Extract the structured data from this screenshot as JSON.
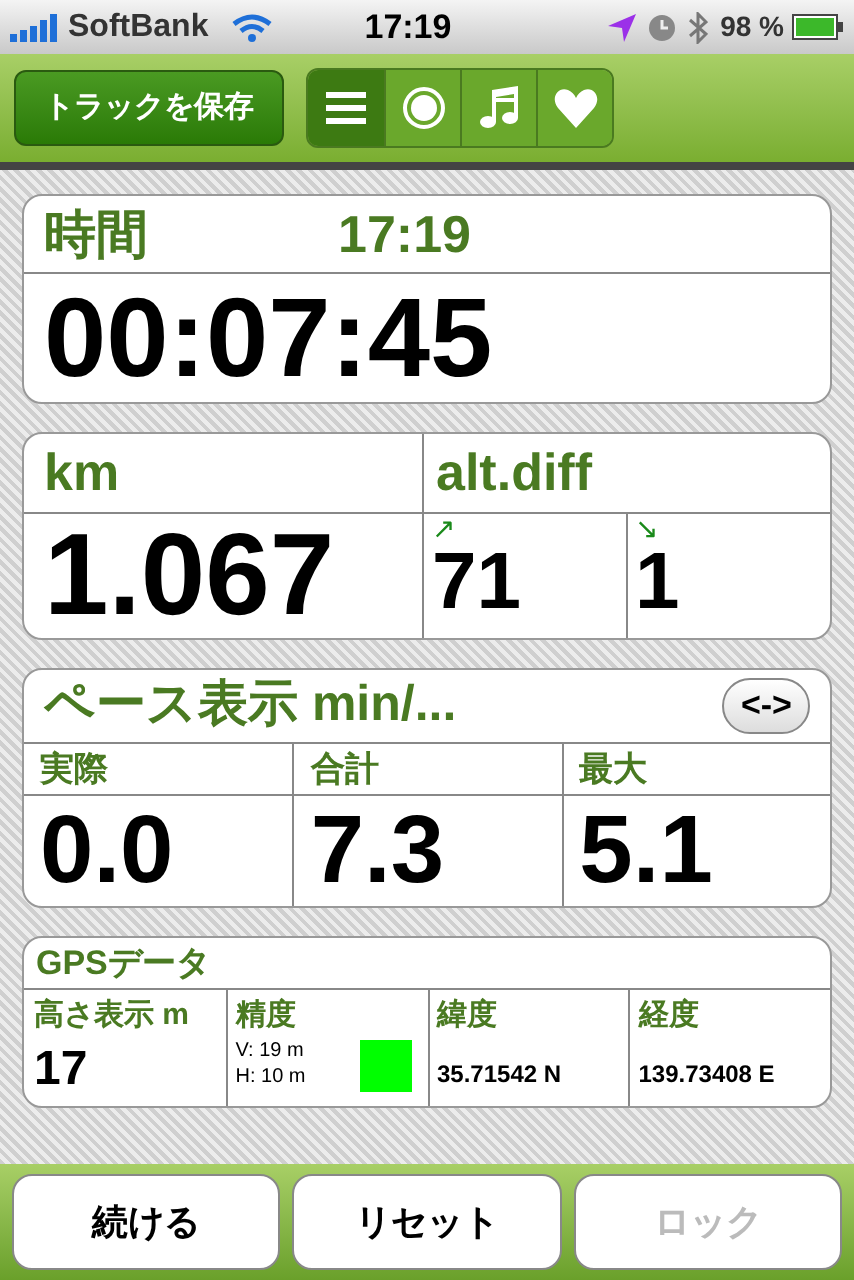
{
  "status_bar": {
    "carrier": "SoftBank",
    "time": "17:19",
    "battery": "98 %"
  },
  "toolbar": {
    "save_button": "トラックを保存",
    "segments": [
      {
        "kind": "list",
        "selected": true
      },
      {
        "kind": "record",
        "selected": false
      },
      {
        "kind": "music",
        "selected": false
      },
      {
        "kind": "heart",
        "selected": false
      }
    ]
  },
  "time_card": {
    "title": "時間",
    "clock": "17:19",
    "elapsed": "00:07:45"
  },
  "distance_card": {
    "unit": "km",
    "distance": "1.067",
    "alt_label": "alt.diff",
    "ascent_arrow": "↗",
    "ascent": "71",
    "descent_arrow": "↘",
    "descent": "1"
  },
  "pace_card": {
    "title": "ペース表示 min/...",
    "toggle": "<->",
    "columns": [
      {
        "label": "実際",
        "value": "0.0"
      },
      {
        "label": "合計",
        "value": "7.3"
      },
      {
        "label": "最大",
        "value": "5.1"
      }
    ]
  },
  "gps_card": {
    "title": "GPSデータ",
    "altitude_label": "高さ表示 m",
    "altitude": "17",
    "accuracy_label": "精度",
    "vertical": "V: 19 m",
    "horizontal": "H: 10 m",
    "signal": {
      "color": "#00ff00"
    },
    "latitude_label": "緯度",
    "latitude": "35.71542 N",
    "longitude_label": "経度",
    "longitude": "139.73408 E"
  },
  "bottom_buttons": [
    {
      "label": "続ける",
      "disabled": false
    },
    {
      "label": "リセット",
      "disabled": false
    },
    {
      "label": "ロック",
      "disabled": true
    }
  ]
}
